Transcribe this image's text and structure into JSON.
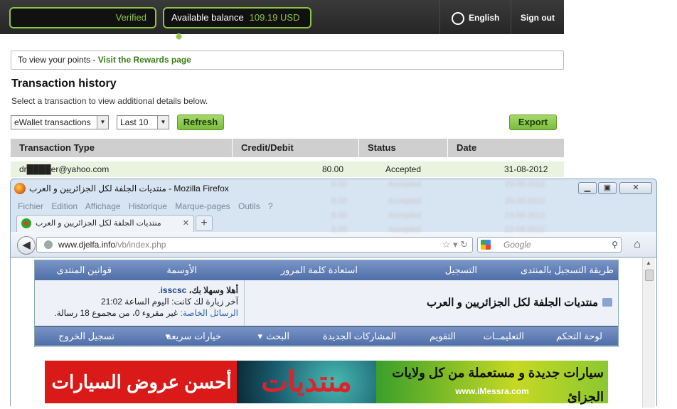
{
  "topbar": {
    "verified": "Verified",
    "balance_label": "Available balance",
    "balance_amount": "109.19 USD",
    "language": "English",
    "sign_out": "Sign out"
  },
  "rewards": {
    "prefix": "To view your points - ",
    "link": "Visit the Rewards page"
  },
  "history": {
    "title": "Transaction history",
    "subtitle": "Select a transaction to view additional details below.",
    "type_select": "eWallet transactions",
    "count_select": "Last 10",
    "refresh": "Refresh",
    "export": "Export",
    "columns": [
      "Transaction Type",
      "Credit/Debit",
      "Status",
      "Date"
    ],
    "rows": [
      {
        "type": "dr████er@yahoo.com",
        "amount": "80.00",
        "status": "Accepted",
        "date": "31-08-2012"
      }
    ],
    "blurred": [
      {
        "amount": "8.00",
        "status": "Accepted",
        "date": "29-08-2012"
      },
      {
        "amount": "8.00",
        "status": "Accepted",
        "date": "29-08-2012"
      },
      {
        "amount": "8.00",
        "status": "Accepted",
        "date": "23-08-2012"
      },
      {
        "amount": "8.00",
        "status": "Accepted",
        "date": "22-08-2012"
      }
    ]
  },
  "firefox": {
    "title": "منتديات الجلفة لكل الجزائريين و العرب - Mozilla Firefox",
    "menu": [
      "Fichier",
      "Edition",
      "Affichage",
      "Historique",
      "Marque-pages",
      "Outils",
      "?"
    ],
    "tab_label": "منتديات الجلفة لكل الجزائريين و العرب",
    "url_domain": "www.djelfa.info",
    "url_path": "/vb/index.php",
    "search_placeholder": "Google"
  },
  "forum": {
    "nav_top": [
      "طريقة التسجيل بالمنتدى",
      "التسجيل",
      "استعادة كلمة المرور",
      "الأوسمة",
      "قوانين المنتدى"
    ],
    "site_title": "منتديات الجلفة لكل الجزائريين و العرب",
    "welcome": "أهلا وسهلا بك،",
    "username": "isscsc",
    "last_visit": "آخر زيارة لك كانت: اليوم الساعة 21:02",
    "pm_link": "الرسائل الخاصة:",
    "pm_text": "غير مقروء 0، من مجموع 18 رسالة.",
    "nav_bottom": [
      "لوحة التحكم",
      "التعليمــات",
      "التقويم",
      "المشاركات الجديدة",
      "البحث",
      "خيارات سريعة",
      "تسجيل الخروج"
    ]
  },
  "banners": {
    "left": "أحسن عروض السيارات",
    "middle": "منتديات",
    "right": "سيارات جديدة و مستعملة من كل ولايات الجزائ",
    "right_sub": "www.iMessra.com"
  }
}
